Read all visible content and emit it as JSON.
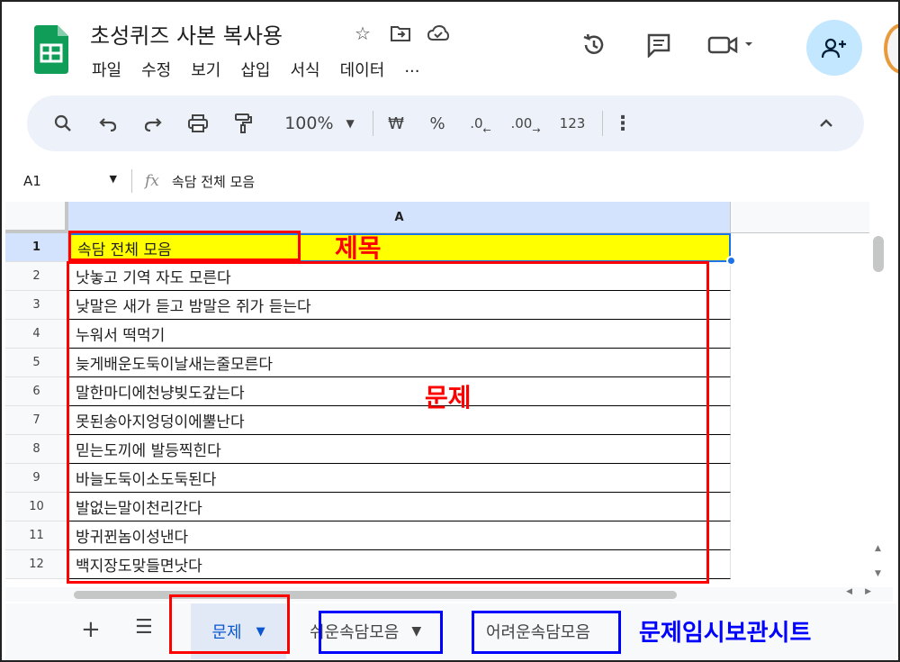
{
  "header": {
    "title": "초성퀴즈 사본 복사용",
    "menu": [
      "파일",
      "수정",
      "보기",
      "삽입",
      "서식",
      "데이터",
      "..."
    ],
    "brand_color": "#0f9d58"
  },
  "toolbar": {
    "zoom": "100%",
    "currency": "₩",
    "percent": "%",
    "dec_less": ".0",
    "dec_more": ".00",
    "number_format": "123"
  },
  "formula_bar": {
    "cell_ref": "A1",
    "fx": "fx",
    "content": "속담 전체 모음"
  },
  "grid": {
    "column_header": "A",
    "rows": [
      {
        "num": "1",
        "text": "속담 전체 모음"
      },
      {
        "num": "2",
        "text": "낫놓고 기역 자도 모른다"
      },
      {
        "num": "3",
        "text": "낮말은 새가 듣고 밤말은 쥐가 듣는다"
      },
      {
        "num": "4",
        "text": "누워서 떡먹기"
      },
      {
        "num": "5",
        "text": "늦게배운도둑이날새는줄모른다"
      },
      {
        "num": "6",
        "text": "말한마디에천냥빚도갚는다"
      },
      {
        "num": "7",
        "text": "못된송아지엉덩이에뿔난다"
      },
      {
        "num": "8",
        "text": "믿는도끼에 발등찍힌다"
      },
      {
        "num": "9",
        "text": "바늘도둑이소도둑된다"
      },
      {
        "num": "10",
        "text": "발없는말이천리간다"
      },
      {
        "num": "11",
        "text": "방귀뀐놈이성낸다"
      },
      {
        "num": "12",
        "text": "백지장도맞들면낫다"
      }
    ]
  },
  "sheets": {
    "active": "문제",
    "tab2": "쉬운속담모음",
    "tab3": "어려운속담모음"
  },
  "annotations": {
    "title_label": "제목",
    "problem_label": "문제",
    "temp_sheet_label": "문제임시보관시트"
  }
}
